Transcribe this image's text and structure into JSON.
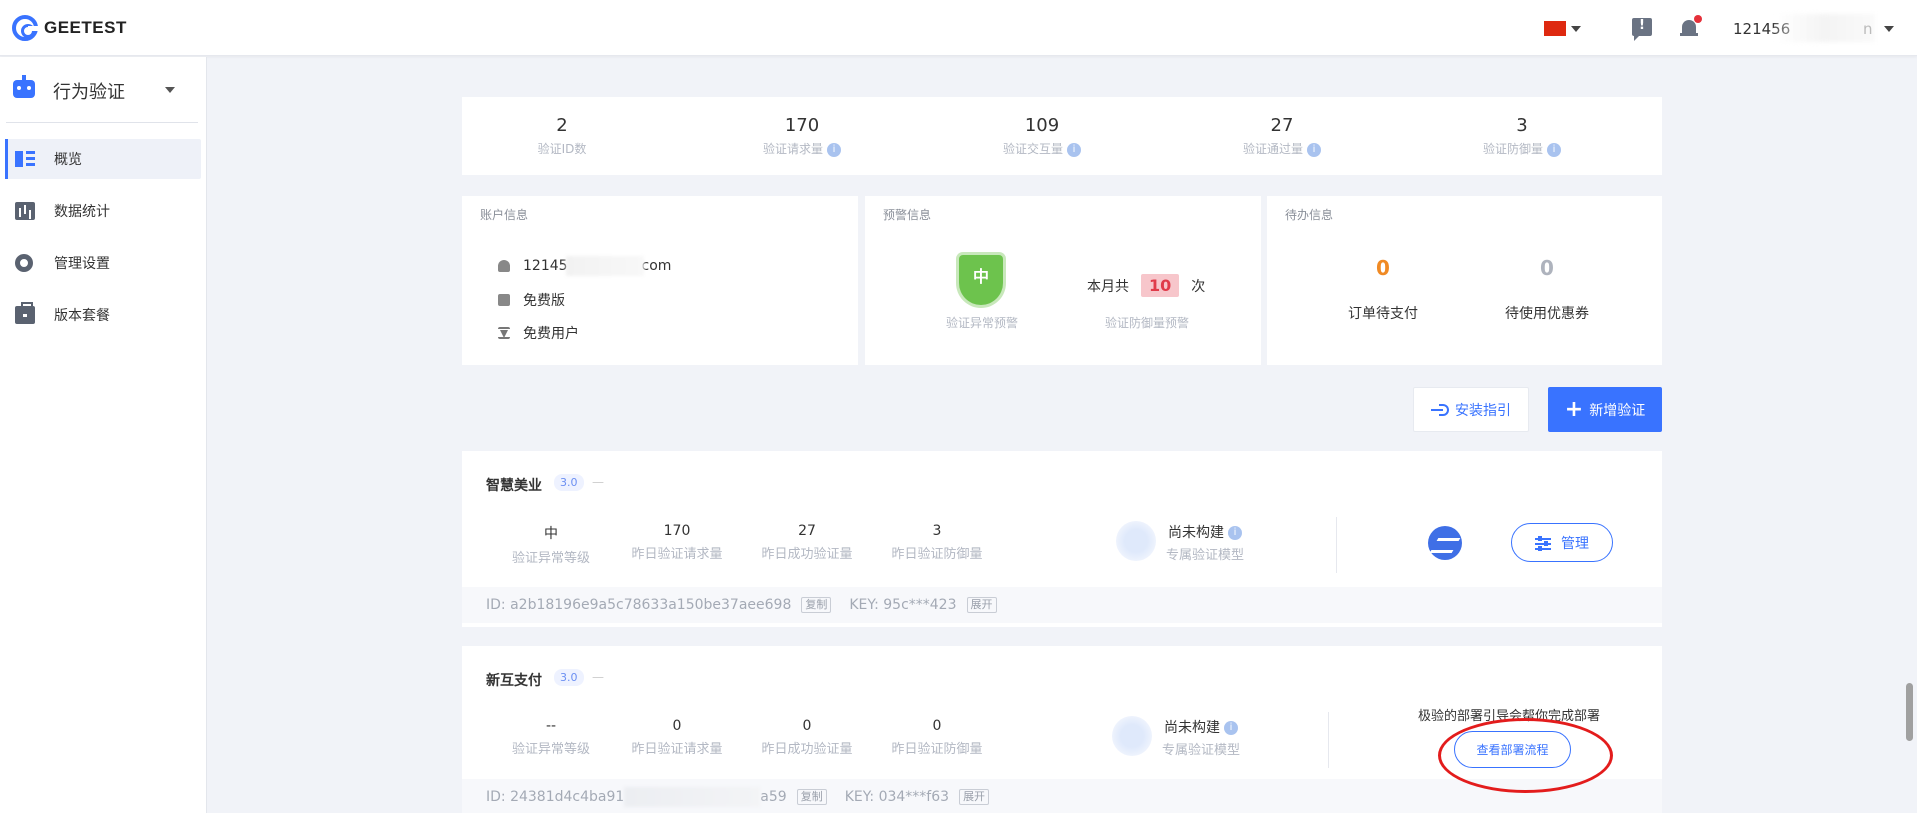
{
  "header": {
    "logo_text": "GEETEST",
    "user_name_visible": "121456",
    "user_name_suffix": "n"
  },
  "sidebar": {
    "product_title": "行为验证",
    "items": [
      {
        "label": "概览",
        "icon": "overview-icon",
        "active": true
      },
      {
        "label": "数据统计",
        "icon": "bar-chart-icon",
        "active": false
      },
      {
        "label": "管理设置",
        "icon": "gear-icon",
        "active": false
      },
      {
        "label": "版本套餐",
        "icon": "package-icon",
        "active": false
      }
    ]
  },
  "stats": [
    {
      "value": "2",
      "label": "验证ID数",
      "info": false
    },
    {
      "value": "170",
      "label": "验证请求量",
      "info": true
    },
    {
      "value": "109",
      "label": "验证交互量",
      "info": true
    },
    {
      "value": "27",
      "label": "验证通过量",
      "info": true
    },
    {
      "value": "3",
      "label": "验证防御量",
      "info": true
    }
  ],
  "account": {
    "title": "账户信息",
    "email_start": "12145",
    "email_end": "com",
    "plan": "免费版",
    "user_type": "免费用户"
  },
  "warning": {
    "title": "预警信息",
    "level": "中",
    "level_label": "验证异常预警",
    "month_prefix": "本月共",
    "month_count": "10",
    "month_suffix": "次",
    "defense_label": "验证防御量预警"
  },
  "todo": {
    "title": "待办信息",
    "orders_count": "0",
    "orders_label": "订单待支付",
    "coupons_count": "0",
    "coupons_label": "待使用优惠券"
  },
  "actions": {
    "guide_label": "安装指引",
    "new_label": "新增验证"
  },
  "apps": [
    {
      "name": "智慧美业",
      "version": "3.0",
      "metrics": [
        {
          "value": "中",
          "label": "验证异常等级"
        },
        {
          "value": "170",
          "label": "昨日验证请求量"
        },
        {
          "value": "27",
          "label": "昨日成功验证量"
        },
        {
          "value": "3",
          "label": "昨日验证防御量"
        }
      ],
      "model_title": "尚未构建",
      "model_label": "专属验证模型",
      "manage_label": "管理",
      "id_text": "ID: a2b18196e9a5c78633a150be37aee698",
      "copy_label": "复制",
      "key_text": "KEY: 95c***423",
      "expand_label": "展开"
    },
    {
      "name": "新互支付",
      "version": "3.0",
      "metrics": [
        {
          "value": "--",
          "label": "验证异常等级"
        },
        {
          "value": "0",
          "label": "昨日验证请求量"
        },
        {
          "value": "0",
          "label": "昨日成功验证量"
        },
        {
          "value": "0",
          "label": "昨日验证防御量"
        }
      ],
      "model_title": "尚未构建",
      "model_label": "专属验证模型",
      "deploy_text": "极验的部署引导会帮你完成部署",
      "deploy_button": "查看部署流程",
      "id_start": "ID: 24381d4c4ba91",
      "id_end": "a59",
      "copy_label": "复制",
      "key_text": "KEY: 034***f63",
      "expand_label": "展开"
    }
  ],
  "colors": {
    "primary": "#3973ff",
    "orange": "#f08a24",
    "grey_zero": "#aeb3bd",
    "shield": "#6dc34d",
    "badge_red": "#e03b4a",
    "annotation_red": "#e31c1c"
  }
}
